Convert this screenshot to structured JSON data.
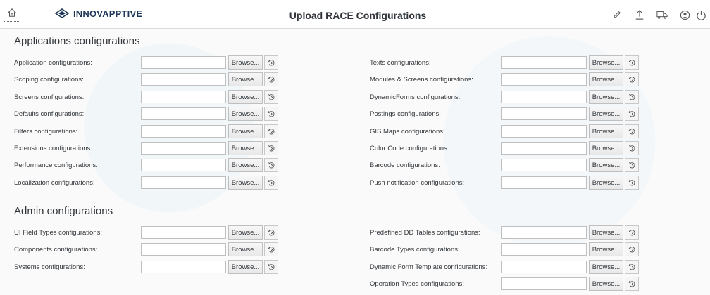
{
  "header": {
    "logo_text": "INNOVAPPTIVE",
    "title": "Upload RACE Configurations",
    "icons": [
      "home-icon",
      "edit-icon",
      "upload-icon",
      "truck-icon",
      "user-icon",
      "power-icon"
    ]
  },
  "browse_label": "Browse...",
  "sections": {
    "applications": {
      "title": "Applications configurations",
      "left": [
        "Application configurations:",
        "Scoping configurations:",
        "Screens configurations:",
        "Defaults configurations:",
        "Filters configurations:",
        "Extensions configurations:",
        "Performance configurations:",
        "Localization configurations:"
      ],
      "right": [
        "Texts configurations:",
        "Modules & Screens configurations:",
        "DynamicForms configurations:",
        "Postings configurations:",
        "GIS Maps configurations:",
        "Color Code configurations:",
        "Barcode configurations:",
        "Push notification configurations:"
      ]
    },
    "admin": {
      "title": "Admin configurations",
      "left": [
        "UI Field Types configurations:",
        "Components configurations:",
        "Systems configurations:"
      ],
      "right": [
        "Predefined DD Tables configurations:",
        "Barcode Types configurations:",
        "Dynamic Form Template configurations:",
        "Operation Types configurations:"
      ]
    }
  },
  "colors": {
    "brand": "#1d3557",
    "header_text": "#32363a"
  }
}
